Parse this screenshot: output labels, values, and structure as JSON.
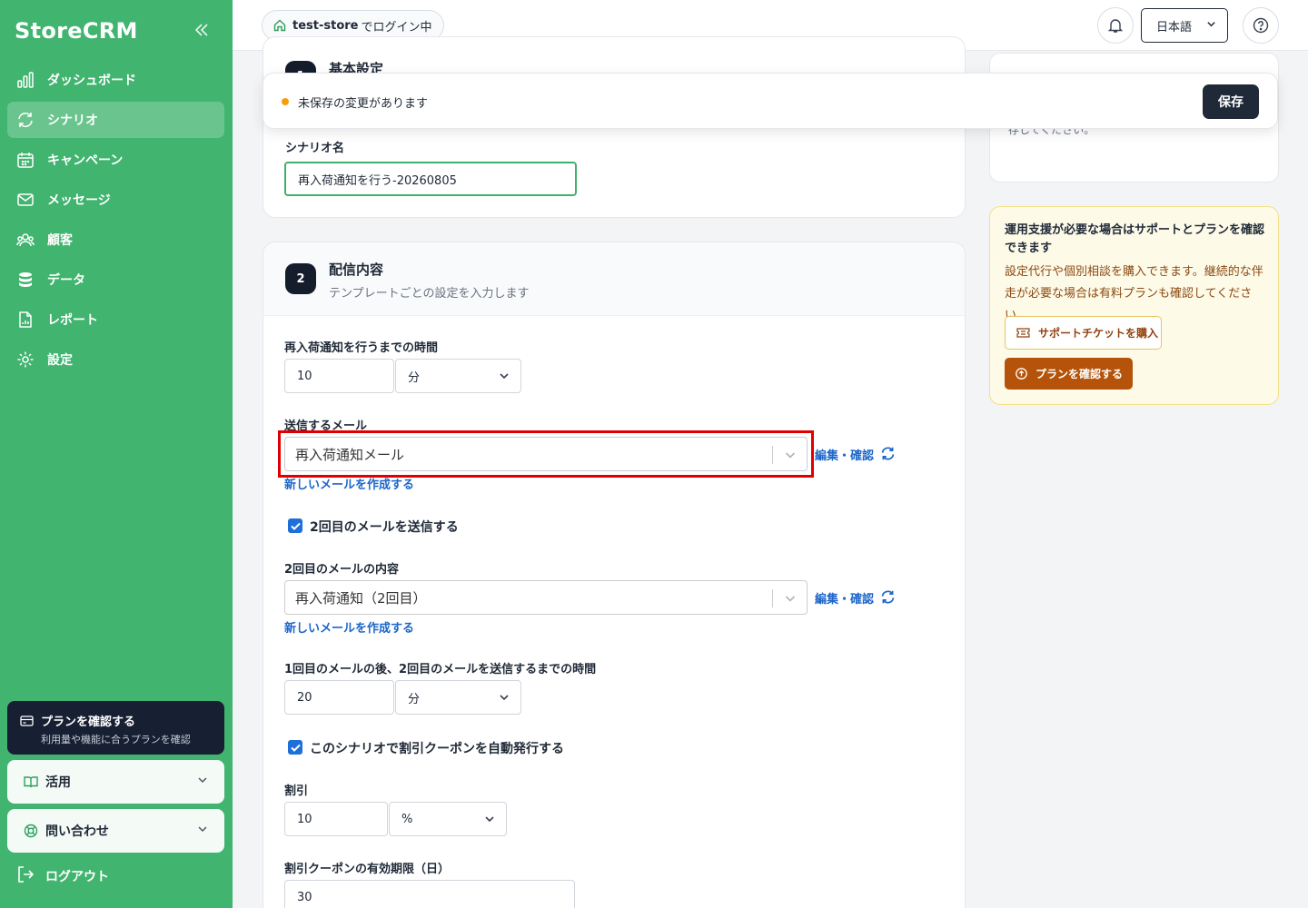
{
  "sidebar": {
    "logo": "StoreCRM",
    "items": [
      {
        "label": "ダッシュボード",
        "icon": "chart-icon"
      },
      {
        "label": "シナリオ",
        "icon": "refresh-icon",
        "active": true
      },
      {
        "label": "キャンペーン",
        "icon": "calendar-icon"
      },
      {
        "label": "メッセージ",
        "icon": "mail-icon"
      },
      {
        "label": "顧客",
        "icon": "users-icon"
      },
      {
        "label": "データ",
        "icon": "database-icon"
      },
      {
        "label": "レポート",
        "icon": "file-chart-icon"
      },
      {
        "label": "設定",
        "icon": "gear-icon"
      }
    ],
    "plan_card": {
      "title": "プランを確認する",
      "subtitle": "利用量や機能に合うプランを確認"
    },
    "accordion_1": "活用",
    "accordion_2": "問い合わせ",
    "logout": "ログアウト"
  },
  "topbar": {
    "store_name": "test-store",
    "login_text": "でログイン中",
    "language": "日本語"
  },
  "unsaved": {
    "text": "未保存の変更があります",
    "save": "保存"
  },
  "section1": {
    "number": "1",
    "title": "基本設定",
    "name_label": "シナリオ名",
    "name_value": "再入荷通知を行う-20260805"
  },
  "section2": {
    "number": "2",
    "title": "配信内容",
    "subtitle": "テンプレートごとの設定を入力します",
    "wait_label": "再入荷通知を行うまでの時間",
    "wait_value": "10",
    "wait_unit": "分",
    "mail_label": "送信するメール",
    "mail_value": "再入荷通知メール",
    "edit_link": "編集・確認",
    "new_mail_link": "新しいメールを作成する",
    "second_mail_checkbox": "2回目のメールを送信する",
    "second_mail_label": "2回目のメールの内容",
    "second_mail_value": "再入荷通知（2回目）",
    "second_edit_link": "編集・確認",
    "second_new_mail_link": "新しいメールを作成する",
    "interval_label": "1回目のメールの後、2回目のメールを送信するまでの時間",
    "interval_value": "20",
    "interval_unit": "分",
    "coupon_checkbox": "このシナリオで割引クーポンを自動発行する",
    "discount_label": "割引",
    "discount_value": "10",
    "discount_unit": "%",
    "expiry_label": "割引クーポンの有効期限（日）",
    "expiry_value": "30"
  },
  "info_card": {
    "text": "シナリオ名、配信内容、実行条件を確認してから保存してください。"
  },
  "support": {
    "heading": "運用支援が必要な場合はサポートとプランを確認できます",
    "description": "設定代行や個別相談を購入できます。継続的な伴走が必要な場合は有料プランも確認してください。",
    "ticket_button": "サポートチケットを購入",
    "plan_button": "プランを確認する"
  },
  "colors": {
    "sidebar": "#41b46f",
    "dark": "#1f2937",
    "link": "#1d66c9",
    "highlight": "#e00000",
    "support_bg": "#fefae8",
    "plan_button": "#b45309"
  }
}
